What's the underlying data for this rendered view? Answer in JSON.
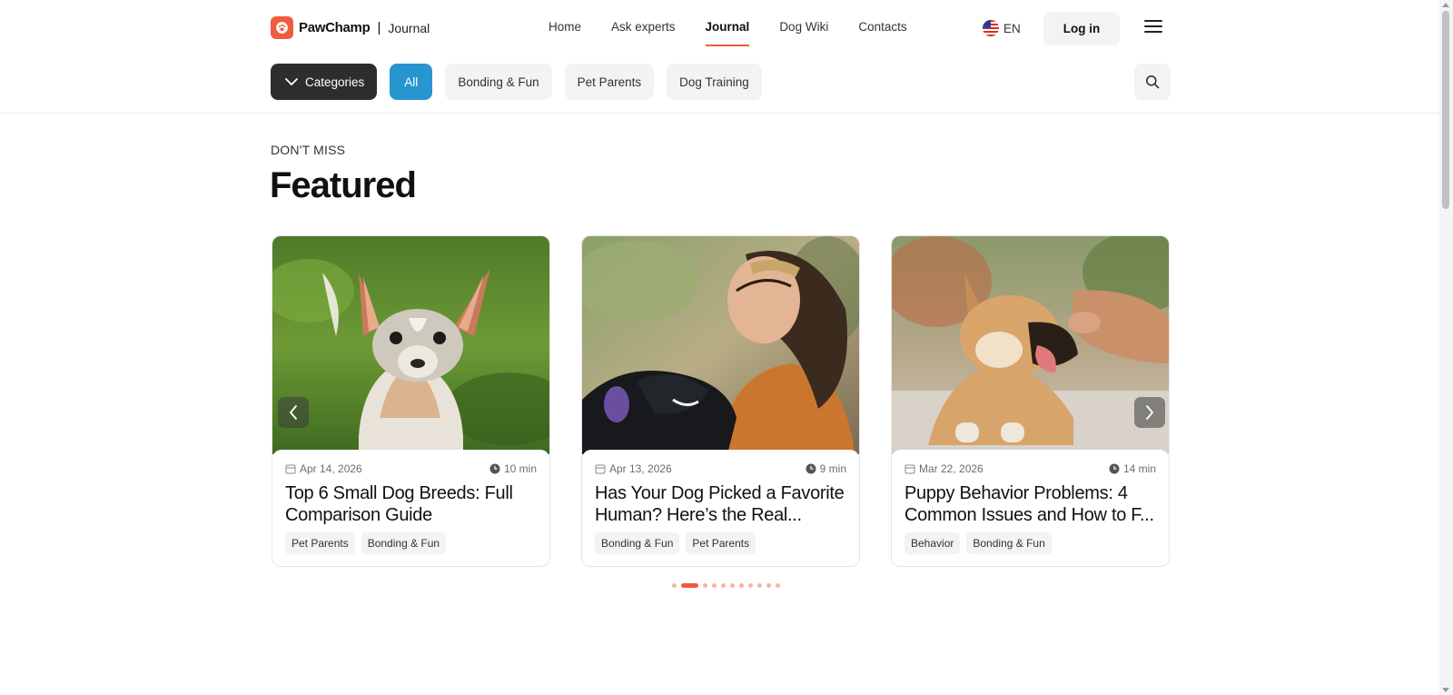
{
  "header": {
    "brand": "PawChamp",
    "separator": "|",
    "sub": "Journal",
    "nav": [
      {
        "label": "Home",
        "active": false
      },
      {
        "label": "Ask experts",
        "active": false
      },
      {
        "label": "Journal",
        "active": true
      },
      {
        "label": "Dog Wiki",
        "active": false
      },
      {
        "label": "Contacts",
        "active": false
      }
    ],
    "language": "EN",
    "login_label": "Log in"
  },
  "categories": {
    "toggle_label": "Categories",
    "chips": [
      {
        "label": "All",
        "active": true
      },
      {
        "label": "Bonding & Fun",
        "active": false
      },
      {
        "label": "Pet Parents",
        "active": false
      },
      {
        "label": "Dog Training",
        "active": false
      }
    ]
  },
  "featured": {
    "eyebrow": "DON'T MISS",
    "title": "Featured",
    "cards": [
      {
        "date": "Apr 14, 2026",
        "read_time": "10 min",
        "title": "Top 6 Small Dog Breeds: Full Comparison Guide",
        "tags": [
          "Pet Parents",
          "Bonding & Fun"
        ]
      },
      {
        "date": "Apr 13, 2026",
        "read_time": "9 min",
        "title": "Has Your Dog Picked a Favorite Human? Here’s the Real...",
        "tags": [
          "Bonding & Fun",
          "Pet Parents"
        ]
      },
      {
        "date": "Mar 22, 2026",
        "read_time": "14 min",
        "title": "Puppy Behavior Problems: 4 Common Issues and How to F...",
        "tags": [
          "Behavior",
          "Bonding & Fun"
        ]
      }
    ],
    "pagination": {
      "total": 11,
      "active_index": 1
    }
  },
  "colors": {
    "accent": "#f05b3f",
    "active_chip": "#2796d0",
    "dark_chip": "#2d2d2d"
  }
}
